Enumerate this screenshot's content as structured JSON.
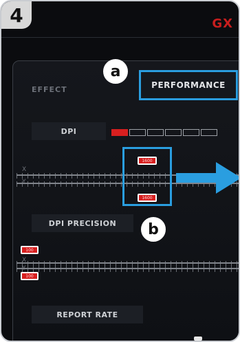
{
  "step_number": "4",
  "brand": "GX",
  "tabs": [
    {
      "label": "EFFECT",
      "active": false
    },
    {
      "label": "PERFORMANCE",
      "active": true
    }
  ],
  "callouts": {
    "a": "a",
    "b": "b"
  },
  "dpi": {
    "label": "DPI",
    "slots": [
      true,
      false,
      false,
      false,
      false,
      false
    ],
    "axis_x": "X",
    "axis_y": "Y",
    "x_value": "1600",
    "y_value": "1600"
  },
  "dpi_precision": {
    "label": "DPI PRECISION",
    "axis_x": "X",
    "axis_y": "Y",
    "x_value": "100",
    "y_value": "100"
  },
  "report_rate": {
    "label": "REPORT RATE"
  },
  "colors": {
    "accent_highlight": "#2a9ee0",
    "active_red": "#d81f1f",
    "brand_red": "#c81e1e",
    "panel_bg": "#0b0c0f"
  }
}
